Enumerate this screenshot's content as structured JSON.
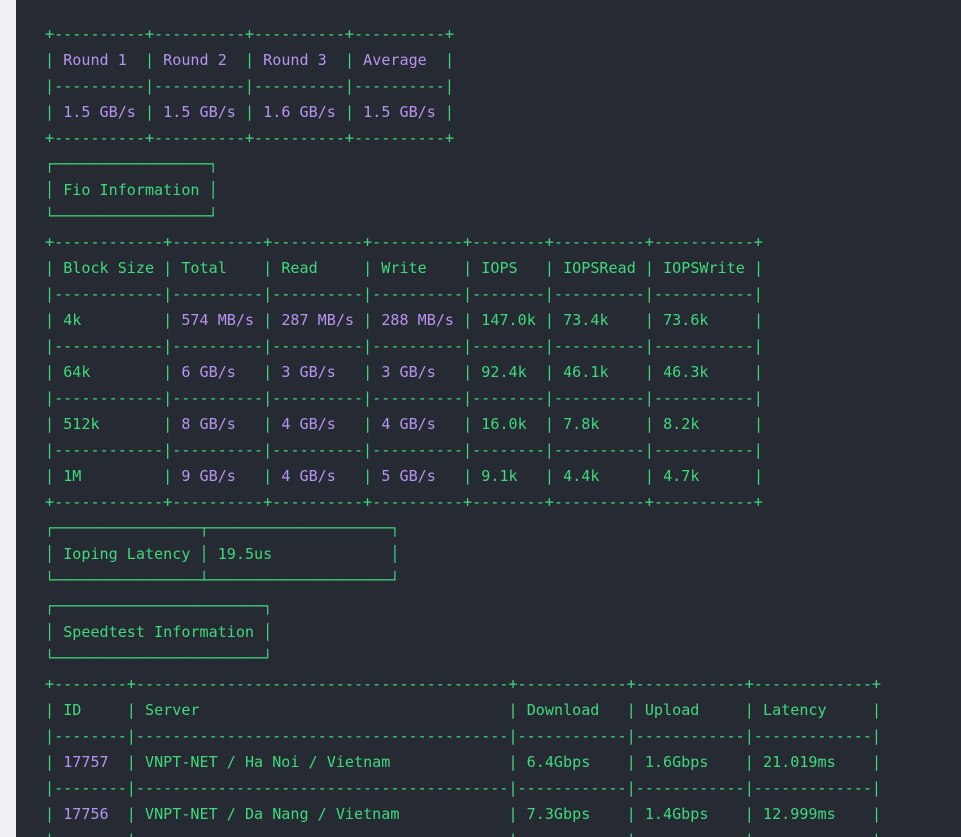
{
  "theme": {
    "background": "#262a33",
    "border": "#3fd97c",
    "text": "#3fd97c",
    "value": "#b694f0"
  },
  "dd_table": {
    "headers": [
      "Round 1",
      "Round 2",
      "Round 3",
      "Average"
    ],
    "row": [
      "1.5 GB/s",
      "1.5 GB/s",
      "1.6 GB/s",
      "1.5 GB/s"
    ]
  },
  "fio_title": "Fio Information",
  "fio_table": {
    "headers": [
      "Block Size",
      "Total",
      "Read",
      "Write",
      "IOPS",
      "IOPSRead",
      "IOPSWrite"
    ],
    "rows": [
      [
        "4k",
        "574 MB/s",
        "287 MB/s",
        "288 MB/s",
        "147.0k",
        "73.4k",
        "73.6k"
      ],
      [
        "64k",
        "6 GB/s",
        "3 GB/s",
        "3 GB/s",
        "92.4k",
        "46.1k",
        "46.3k"
      ],
      [
        "512k",
        "8 GB/s",
        "4 GB/s",
        "4 GB/s",
        "16.0k",
        "7.8k",
        "8.2k"
      ],
      [
        "1M",
        "9 GB/s",
        "4 GB/s",
        "5 GB/s",
        "9.1k",
        "4.4k",
        "4.7k"
      ]
    ]
  },
  "ioping": {
    "label": "Ioping Latency",
    "value": "19.5us"
  },
  "speedtest_title": "Speedtest Information",
  "speedtest_table": {
    "headers": [
      "ID",
      "Server",
      "Download",
      "Upload",
      "Latency"
    ],
    "rows": [
      [
        "17757",
        "VNPT-NET / Ha Noi / Vietnam",
        "6.4Gbps",
        "1.6Gbps",
        "21.019ms"
      ],
      [
        "17756",
        "VNPT-NET / Da Nang / Vietnam",
        "7.3Gbps",
        "1.4Gbps",
        "12.999ms"
      ]
    ]
  }
}
